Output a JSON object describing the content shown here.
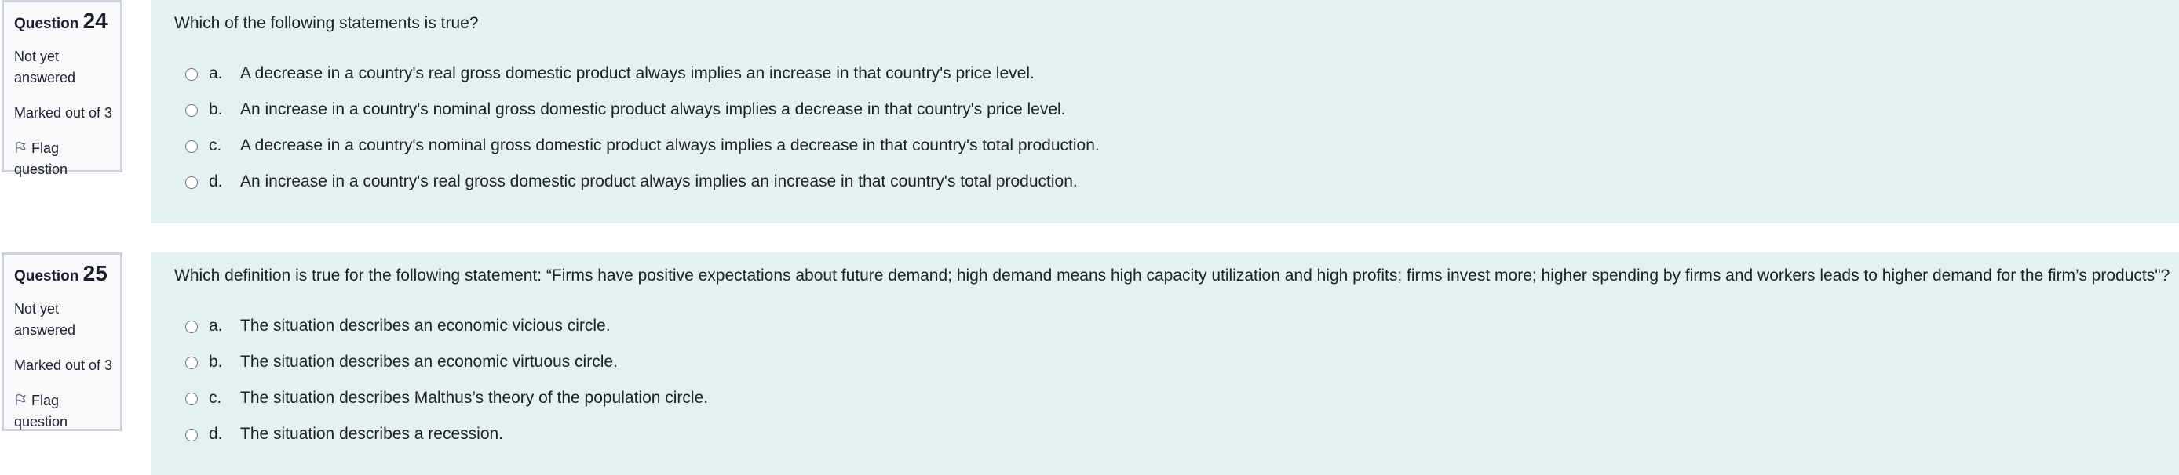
{
  "questions": [
    {
      "label": "Question",
      "number": "24",
      "state": "Not yet answered",
      "grade": "Marked out of 3",
      "flag_label": "Flag question",
      "text": "Which of the following statements is true?",
      "answers": [
        {
          "letter": "a.",
          "text": "A decrease in a country's real gross domestic product always implies an increase in that country's price level."
        },
        {
          "letter": "b.",
          "text": "An increase in a country's nominal gross domestic product always implies a decrease in that country's price level."
        },
        {
          "letter": "c.",
          "text": "A decrease in a country's nominal gross domestic product always implies a decrease in that country's total production."
        },
        {
          "letter": "d.",
          "text": "An increase in a country's real gross domestic product always implies an increase in that country's total production."
        }
      ]
    },
    {
      "label": "Question",
      "number": "25",
      "state": "Not yet answered",
      "grade": "Marked out of 3",
      "flag_label": "Flag question",
      "text": "Which definition is true for the following statement: “Firms have positive expectations about future demand; high demand means high capacity utilization and high profits; firms invest more; higher spending by firms and workers leads to higher demand for the firm’s products\"?",
      "answers": [
        {
          "letter": "a.",
          "text": "The situation describes an economic vicious circle."
        },
        {
          "letter": "b.",
          "text": "The situation describes an economic virtuous circle."
        },
        {
          "letter": "c.",
          "text": "The situation describes Malthus’s theory of the population circle."
        },
        {
          "letter": "d.",
          "text": "The situation describes a recession."
        }
      ]
    }
  ],
  "icons": {
    "flag": "flag-outline-icon",
    "radio": "radio-unchecked"
  },
  "colors": {
    "info_bg": "#f8f9fa",
    "info_border": "#cfd4da",
    "content_bg": "#e3f1f2",
    "text": "#1d2125"
  }
}
